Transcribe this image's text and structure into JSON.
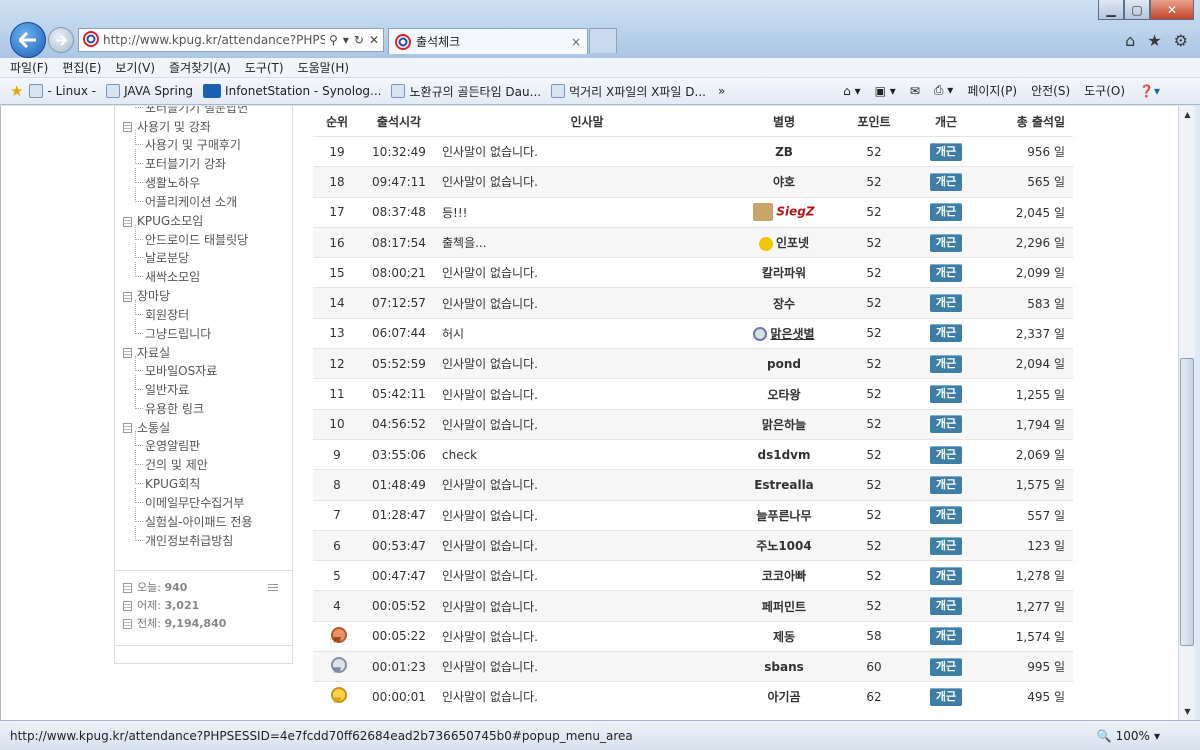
{
  "browser": {
    "address_url": "http://www.kpug.kr/attendance?PHPSE",
    "tab_title": "출석체크",
    "status_url": "http://www.kpug.kr/attendance?PHPSESSID=4e7fcdd70ff62684ead2b736650745b0#popup_menu_area",
    "zoom": "100%",
    "menu": [
      "파일(F)",
      "편집(E)",
      "보기(V)",
      "즐겨찾기(A)",
      "도구(T)",
      "도움말(H)"
    ],
    "favorites": [
      "- Linux -",
      "JAVA Spring",
      "InfonetStation - Synolog...",
      "노환규의 골든타임  Dau...",
      "먹거리 X파일의 X파일  D..."
    ],
    "commands": [
      "페이지(P)",
      "안전(S)",
      "도구(O)"
    ],
    "colors": {
      "accent_button": "#3d7ea6",
      "chrome": "#b9d1ea"
    }
  },
  "sidebar": {
    "cut_item": "포터블기기 질문답변",
    "groups": [
      {
        "label": "사용기 및 강좌",
        "items": [
          "사용기 및 구매후기",
          "포터블기기 강좌",
          "생활노하우",
          "어플리케이션 소개"
        ]
      },
      {
        "label": "KPUG소모임",
        "items": [
          "안드로이드 태블릿당",
          "날로분당",
          "새싹소모임"
        ]
      },
      {
        "label": "장마당",
        "items": [
          "회원장터",
          "그냥드립니다"
        ]
      },
      {
        "label": "자료실",
        "items": [
          "모바일OS자료",
          "일반자료",
          "유용한 링크"
        ]
      },
      {
        "label": "소통실",
        "items": [
          "운영알림판",
          "건의 및 제안",
          "KPUG회칙",
          "이메일무단수집거부",
          "실험실-아이패드 전용",
          "개인정보취급방침"
        ]
      }
    ],
    "stats": [
      {
        "label": "오늘:",
        "value": "940"
      },
      {
        "label": "어제:",
        "value": "3,021"
      },
      {
        "label": "전체:",
        "value": "9,194,840"
      }
    ]
  },
  "attendance": {
    "headers": {
      "rank": "순위",
      "time": "출석시각",
      "message": "인사말",
      "nick": "별명",
      "point": "포인트",
      "gaegun": "개근",
      "total": "총 출석일"
    },
    "gaegun_label": "개근",
    "rows": [
      {
        "rank": "19",
        "time": "10:32:49",
        "message": "인사말이 없습니다.",
        "nick": "ZB",
        "point": "52",
        "total": "956 일"
      },
      {
        "rank": "18",
        "time": "09:47:11",
        "message": "인사말이 없습니다.",
        "nick": "야호",
        "point": "52",
        "total": "565 일"
      },
      {
        "rank": "17",
        "time": "08:37:48",
        "message": "등!!!",
        "nick": "SiegZ",
        "point": "52",
        "total": "2,045 일",
        "deco": "image-nick"
      },
      {
        "rank": "16",
        "time": "08:17:54",
        "message": "출첵을...",
        "nick": "인포넷",
        "point": "52",
        "total": "2,296 일",
        "deco": "smiley"
      },
      {
        "rank": "15",
        "time": "08:00:21",
        "message": "인사말이 없습니다.",
        "nick": "칼라파워",
        "point": "52",
        "total": "2,099 일"
      },
      {
        "rank": "14",
        "time": "07:12:57",
        "message": "인사말이 없습니다.",
        "nick": "장수",
        "point": "52",
        "total": "583 일"
      },
      {
        "rank": "13",
        "time": "06:07:44",
        "message": "허시",
        "nick": "맑은샛별",
        "point": "52",
        "total": "2,337 일",
        "deco": "star"
      },
      {
        "rank": "12",
        "time": "05:52:59",
        "message": "인사말이 없습니다.",
        "nick": "pond",
        "point": "52",
        "total": "2,094 일"
      },
      {
        "rank": "11",
        "time": "05:42:11",
        "message": "인사말이 없습니다.",
        "nick": "오타왕",
        "point": "52",
        "total": "1,255 일"
      },
      {
        "rank": "10",
        "time": "04:56:52",
        "message": "인사말이 없습니다.",
        "nick": "맑은하늘",
        "point": "52",
        "total": "1,794 일"
      },
      {
        "rank": "9",
        "time": "03:55:06",
        "message": "check",
        "nick": "ds1dvm",
        "point": "52",
        "total": "2,069 일"
      },
      {
        "rank": "8",
        "time": "01:48:49",
        "message": "인사말이 없습니다.",
        "nick": "Estrealla",
        "point": "52",
        "total": "1,575 일"
      },
      {
        "rank": "7",
        "time": "01:28:47",
        "message": "인사말이 없습니다.",
        "nick": "늘푸른나무",
        "point": "52",
        "total": "557 일"
      },
      {
        "rank": "6",
        "time": "00:53:47",
        "message": "인사말이 없습니다.",
        "nick": "주노1004",
        "point": "52",
        "total": "123 일"
      },
      {
        "rank": "5",
        "time": "00:47:47",
        "message": "인사말이 없습니다.",
        "nick": "코코아빠",
        "point": "52",
        "total": "1,278 일"
      },
      {
        "rank": "4",
        "time": "00:05:52",
        "message": "인사말이 없습니다.",
        "nick": "페퍼민트",
        "point": "52",
        "total": "1,277 일"
      },
      {
        "rank": "",
        "medal": "bronze",
        "time": "00:05:22",
        "message": "인사말이 없습니다.",
        "nick": "제동",
        "point": "58",
        "total": "1,574 일"
      },
      {
        "rank": "",
        "medal": "silver",
        "time": "00:01:23",
        "message": "인사말이 없습니다.",
        "nick": "sbans",
        "point": "60",
        "total": "995 일"
      },
      {
        "rank": "",
        "medal": "gold",
        "time": "00:00:01",
        "message": "인사말이 없습니다.",
        "nick": "아기곰",
        "point": "62",
        "total": "495 일"
      }
    ]
  }
}
